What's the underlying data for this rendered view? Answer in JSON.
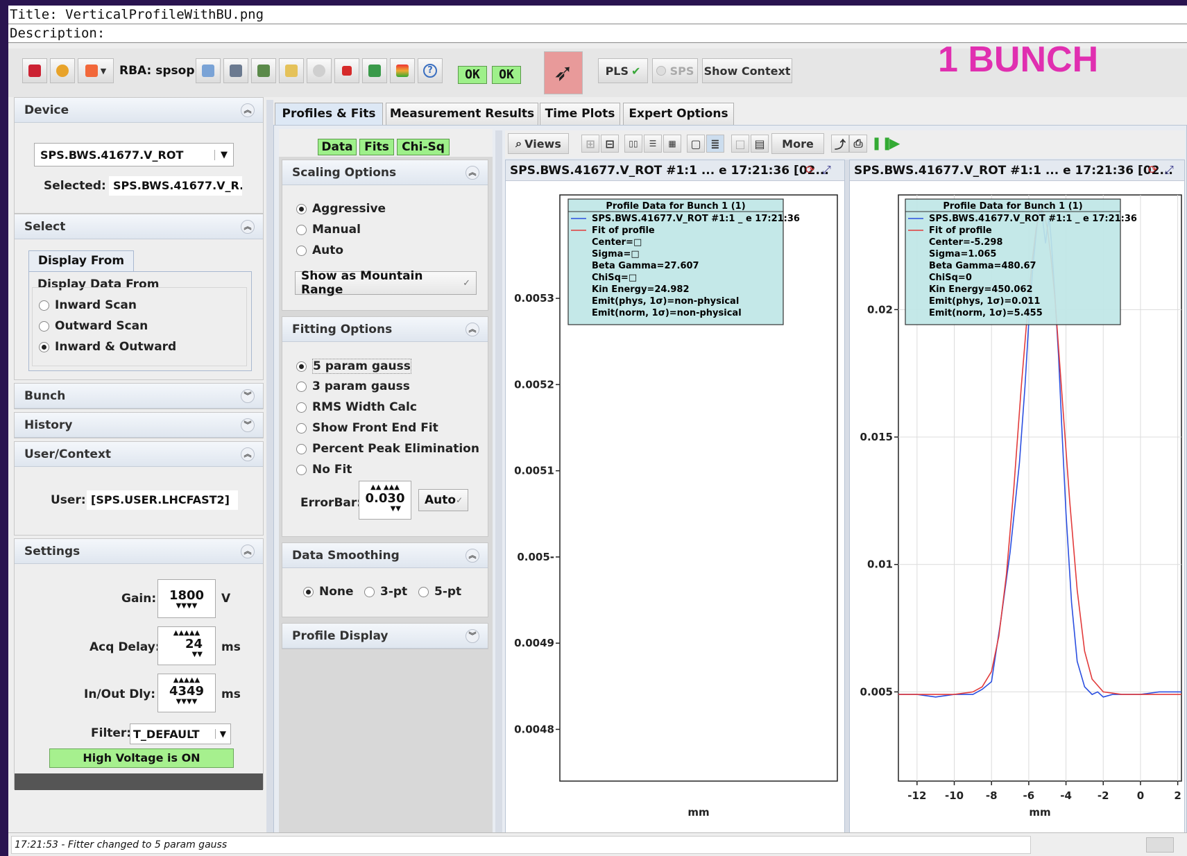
{
  "meta": {
    "title": "Title: VerticalProfileWithBU.png",
    "description": "Description:"
  },
  "overlay": {
    "label": "1 BUNCH"
  },
  "toolbar": {
    "rba": "RBA: spsop",
    "ok1": "OK",
    "ok2": "OK",
    "pls": "PLS",
    "sps": "SPS",
    "show_context": "Show Context"
  },
  "left": {
    "device": {
      "title": "Device",
      "value": "SPS.BWS.41677.V_ROT",
      "selected_label": "Selected:",
      "selected_value": "SPS.BWS.41677.V_R..."
    },
    "select": {
      "title": "Select",
      "tab": "Display From",
      "group": "Display Data From",
      "options": [
        "Inward Scan",
        "Outward Scan",
        "Inward & Outward"
      ],
      "selected": 2
    },
    "bunch": {
      "title": "Bunch"
    },
    "history": {
      "title": "History"
    },
    "user": {
      "title": "User/Context",
      "label": "User:",
      "value": "[SPS.USER.LHCFAST2]"
    },
    "settings": {
      "title": "Settings",
      "gain_label": "Gain:",
      "gain": "1800",
      "gain_unit": "V",
      "acq_label": "Acq Delay:",
      "acq": "24",
      "acq_unit": "ms",
      "inout_label": "In/Out Dly:",
      "inout": "4349",
      "inout_unit": "ms",
      "filter_label": "Filter:",
      "filter": "T_DEFAULT",
      "hv": "High Voltage is ON"
    }
  },
  "tabs": [
    "Profiles & Fits",
    "Measurement Results",
    "Time Plots",
    "Expert Options"
  ],
  "mid": {
    "toggles": [
      "Data",
      "Fits",
      "Chi-Sq"
    ],
    "scaling": {
      "title": "Scaling Options",
      "options": [
        "Aggressive",
        "Manual",
        "Auto"
      ],
      "selected": 0,
      "combo": "Show as Mountain Range"
    },
    "fitting": {
      "title": "Fitting Options",
      "options": [
        "5 param gauss",
        "3 param gauss",
        "RMS Width Calc",
        "Show Front End Fit",
        "Percent Peak Elimination",
        "No Fit"
      ],
      "selected": 0,
      "errorbar_label": "ErrorBar:",
      "errorbar": "0.030",
      "errorbar_mode": "Auto"
    },
    "smoothing": {
      "title": "Data Smoothing",
      "options": [
        "None",
        "3-pt",
        "5-pt"
      ],
      "selected": 0
    },
    "profile_display": {
      "title": "Profile Display"
    }
  },
  "plot_toolbar": {
    "views": "Views",
    "more": "More"
  },
  "status": {
    "text": "17:21:53 - Fitter changed to 5 param gauss"
  },
  "colors": {
    "data": "#2b4fe0",
    "fit": "#e23b3b",
    "legend_bg": "#bfe6e6",
    "hv_bg": "#a6f08e"
  },
  "chart_data": [
    {
      "type": "line",
      "title": "SPS.BWS.41677.V_ROT #1:1  ... e 17:21:36  [02...",
      "xlabel": "mm",
      "ylabel": "",
      "yticks": [
        0.0048,
        0.0049,
        0.005,
        0.0051,
        0.0052,
        0.0053
      ],
      "ytick_labels": [
        "0.0048",
        "0.0049",
        "0.005-",
        "0.0051",
        "0.0052",
        "0.0053"
      ],
      "ylim": [
        0.00474,
        0.00542
      ],
      "legend": {
        "title": "Profile Data for Bunch 1 (1)",
        "entries": [
          "SPS.BWS.41677.V_ROT #1:1  _ e 17:21:36",
          "Fit of profile"
        ],
        "lines": [
          "Center=□",
          "Sigma=□",
          "Beta Gamma=27.607",
          "ChiSq=□",
          "Kin Energy=24.982",
          "Emit(phys, 1σ)=non-physical",
          "Emit(norm, 1σ)=non-physical"
        ]
      },
      "series": []
    },
    {
      "type": "line",
      "title": "SPS.BWS.41677.V_ROT #1:1  ... e 17:21:36  [02...",
      "xlabel": "mm",
      "ylabel": "",
      "xticks": [
        -12,
        -10,
        -8,
        -6,
        -4,
        -2,
        0,
        2
      ],
      "xtick_labels": [
        "-12",
        "-10",
        "-8",
        "-6",
        "-4",
        "-2",
        "0",
        "2"
      ],
      "yticks": [
        0.005,
        0.01,
        0.015,
        0.02
      ],
      "ytick_labels": [
        "0.005",
        "0.01",
        "0.015",
        "0.02"
      ],
      "xlim": [
        -13,
        2.2
      ],
      "ylim": [
        0.0015,
        0.0245
      ],
      "legend": {
        "title": "Profile Data for Bunch 1 (1)",
        "entries": [
          "SPS.BWS.41677.V_ROT #1:1  _ e 17:21:36",
          "Fit of profile"
        ],
        "lines": [
          "Center=-5.298",
          "Sigma=1.065",
          "Beta Gamma=480.67",
          "ChiSq=0",
          "Kin Energy=450.062",
          "Emit(phys, 1σ)=0.011",
          "Emit(norm, 1σ)=5.455"
        ]
      },
      "series": [
        {
          "name": "SPS.BWS.41677.V_ROT #1:1  _ e 17:21:36",
          "color": "#2b4fe0",
          "x": [
            -13,
            -12,
            -11,
            -10,
            -9,
            -8.5,
            -8,
            -7.5,
            -7,
            -6.5,
            -6.2,
            -6,
            -5.8,
            -5.6,
            -5.5,
            -5.4,
            -5.3,
            -5.2,
            -5.1,
            -5.0,
            -4.9,
            -4.8,
            -4.6,
            -4.4,
            -4.2,
            -4,
            -3.7,
            -3.4,
            -3,
            -2.6,
            -2.3,
            -2,
            -1.5,
            -1,
            0,
            1,
            2.2
          ],
          "y": [
            0.0049,
            0.0049,
            0.0048,
            0.0049,
            0.0049,
            0.0051,
            0.0054,
            0.0078,
            0.0105,
            0.014,
            0.017,
            0.0195,
            0.0215,
            0.023,
            0.0237,
            0.024,
            0.0238,
            0.0232,
            0.0226,
            0.0232,
            0.0236,
            0.0228,
            0.0206,
            0.0182,
            0.015,
            0.012,
            0.0085,
            0.0062,
            0.0052,
            0.0049,
            0.005,
            0.0048,
            0.0049,
            0.0049,
            0.0049,
            0.005,
            0.005
          ]
        },
        {
          "name": "Fit of profile",
          "color": "#e23b3b",
          "x": [
            -13,
            -12,
            -11,
            -10,
            -9,
            -8.5,
            -8,
            -7.6,
            -7.2,
            -6.8,
            -6.4,
            -6,
            -5.8,
            -5.6,
            -5.4,
            -5.3,
            -5.2,
            -5.0,
            -4.8,
            -4.6,
            -4.2,
            -3.8,
            -3.4,
            -3,
            -2.6,
            -2,
            -1,
            0,
            1,
            2.2
          ],
          "y": [
            0.0049,
            0.0049,
            0.0049,
            0.0049,
            0.005,
            0.0052,
            0.0058,
            0.0072,
            0.0096,
            0.013,
            0.017,
            0.0205,
            0.022,
            0.0232,
            0.0238,
            0.0239,
            0.0238,
            0.0232,
            0.022,
            0.0205,
            0.0165,
            0.0125,
            0.009,
            0.0066,
            0.0055,
            0.005,
            0.0049,
            0.0049,
            0.0049,
            0.0049
          ]
        }
      ]
    }
  ]
}
